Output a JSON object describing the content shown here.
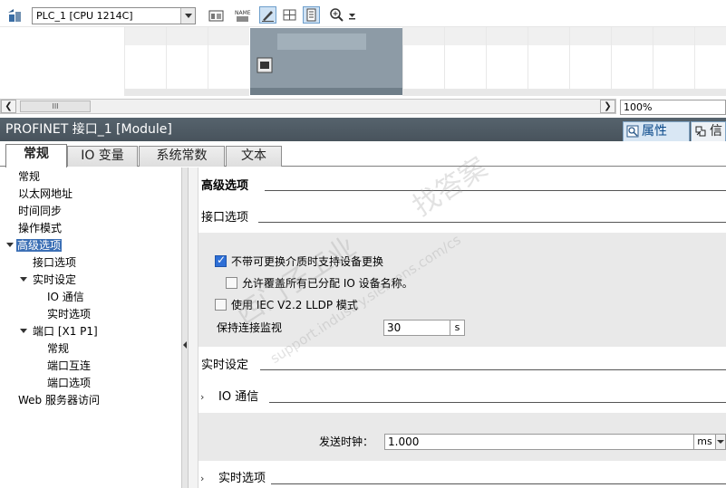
{
  "device_view": {
    "device_selector": "PLC_1 [CPU 1214C]",
    "toolbar_icons": [
      "network-view-icon",
      "device-image-icon",
      "name-label-icon",
      "pen-draw-icon",
      "grid-icon",
      "page-view-icon",
      "zoom-in-icon",
      "zoom-step-icon"
    ],
    "zoom_value": "100%",
    "scroll_thumb_glyph": "III"
  },
  "inspector": {
    "title": "PROFINET 接口_1 [Module]",
    "right_tabs": [
      {
        "label": "属性",
        "icon": "properties-icon"
      },
      {
        "label": "信",
        "icon": "info-icon"
      }
    ],
    "tabs": [
      "常规",
      "IO 变量",
      "系统常数",
      "文本"
    ],
    "active_tab": "常规"
  },
  "tree": [
    {
      "label": "常规",
      "level": 1,
      "expand": false,
      "selected": false
    },
    {
      "label": "以太网地址",
      "level": 1,
      "expand": false,
      "selected": false
    },
    {
      "label": "时间同步",
      "level": 1,
      "expand": false,
      "selected": false
    },
    {
      "label": "操作模式",
      "level": 1,
      "expand": false,
      "selected": false
    },
    {
      "label": "高级选项",
      "level": 1,
      "expand": true,
      "selected": true
    },
    {
      "label": "接口选项",
      "level": 2,
      "expand": false,
      "selected": false
    },
    {
      "label": "实时设定",
      "level": 2,
      "expand": true,
      "selected": false
    },
    {
      "label": "IO 通信",
      "level": 3,
      "expand": false,
      "selected": false
    },
    {
      "label": "实时选项",
      "level": 3,
      "expand": false,
      "selected": false
    },
    {
      "label": "端口 [X1 P1]",
      "level": 2,
      "expand": true,
      "selected": false
    },
    {
      "label": "常规",
      "level": 3,
      "expand": false,
      "selected": false
    },
    {
      "label": "端口互连",
      "level": 3,
      "expand": false,
      "selected": false
    },
    {
      "label": "端口选项",
      "level": 3,
      "expand": false,
      "selected": false
    },
    {
      "label": "Web 服务器访问",
      "level": 1,
      "expand": false,
      "selected": false
    }
  ],
  "content": {
    "section_title": "高级选项",
    "interface_options": {
      "heading": "接口选项",
      "checkbox_device_replace": {
        "label": "不带可更换介质时支持设备更换",
        "checked": true
      },
      "checkbox_overwrite_names": {
        "label": "允许覆盖所有已分配 IO 设备名称。",
        "checked": false
      },
      "checkbox_lldp": {
        "label": "使用 IEC V2.2 LLDP 模式",
        "checked": false
      },
      "keepalive_label": "保持连接监视",
      "keepalive_value": "30",
      "keepalive_unit": "s"
    },
    "realtime": {
      "heading": "实时设定",
      "io_comm_heading": "IO 通信",
      "send_clock_label": "发送时钟：",
      "send_clock_value": "1.000",
      "send_clock_unit": "ms",
      "rt_options_heading": "实时选项"
    }
  },
  "watermark": {
    "line1": "西门子工业",
    "line2": "找答案",
    "line3": "support.industry.siemens.com/cs"
  }
}
